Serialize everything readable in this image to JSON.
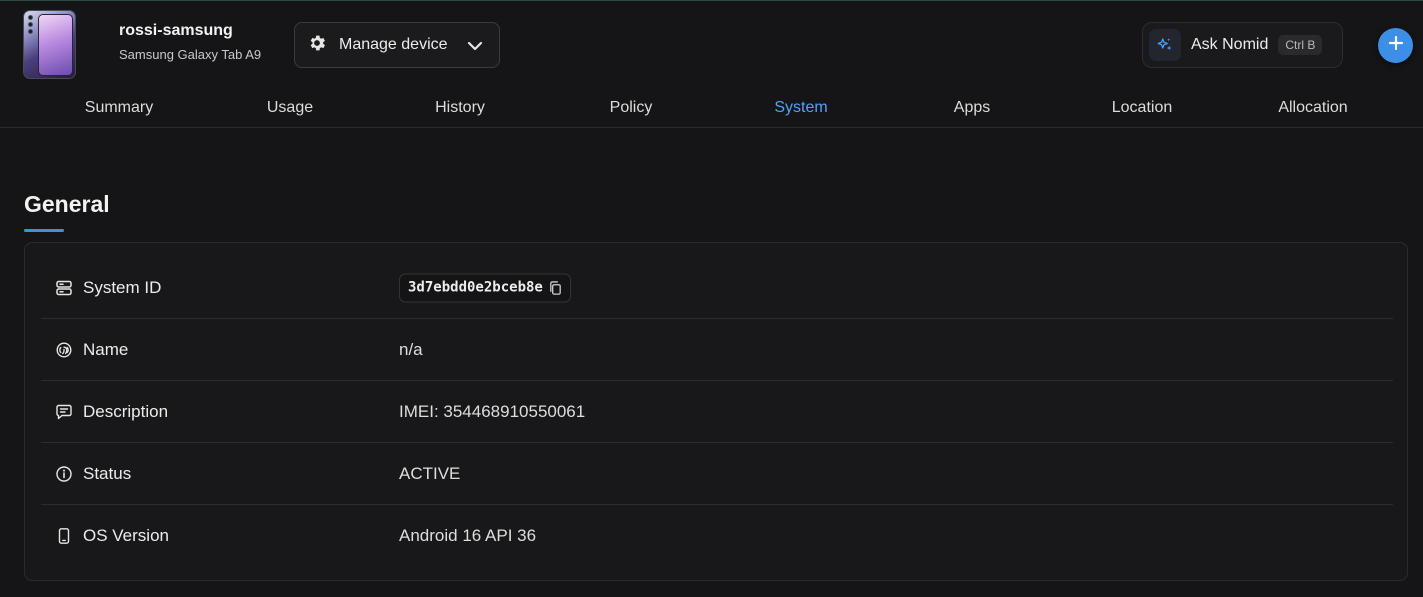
{
  "device": {
    "name": "rossi-samsung",
    "model": "Samsung Galaxy Tab A9"
  },
  "header": {
    "manage_label": "Manage device",
    "ask_label": "Ask Nomid",
    "ask_shortcut": "Ctrl B"
  },
  "tabs": [
    {
      "label": "Summary"
    },
    {
      "label": "Usage"
    },
    {
      "label": "History"
    },
    {
      "label": "Policy"
    },
    {
      "label": "System",
      "active": true
    },
    {
      "label": "Apps"
    },
    {
      "label": "Location"
    },
    {
      "label": "Allocation"
    }
  ],
  "section": {
    "title": "General"
  },
  "rows": [
    {
      "label": "System ID",
      "value": "3d7ebdd0e2bceb8e",
      "icon": "server-icon"
    },
    {
      "label": "Name",
      "value": "n/a",
      "icon": "fingerprint-icon"
    },
    {
      "label": "Description",
      "value": "IMEI: 354468910550061",
      "icon": "comment-icon"
    },
    {
      "label": "Status",
      "value": "ACTIVE",
      "icon": "info-icon"
    },
    {
      "label": "OS Version",
      "value": "Android 16 API 36",
      "icon": "phone-icon"
    }
  ],
  "colors": {
    "accent": "#3b8fe6",
    "active_tab": "#4da3ff",
    "background": "#151517"
  }
}
